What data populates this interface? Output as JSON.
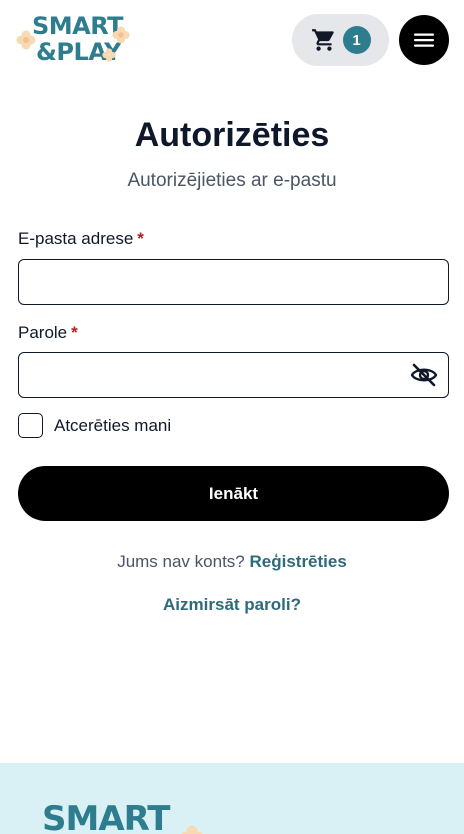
{
  "header": {
    "logo_line1": "SMART",
    "logo_line2": "&PLAY",
    "cart_count": "1",
    "cart_icon": "shopping-cart-icon",
    "menu_icon": "hamburger-menu-icon"
  },
  "login": {
    "title": "Autorizēties",
    "subtitle": "Autorizējieties ar e-pastu",
    "email_label": "E-pasta adrese",
    "password_label": "Parole",
    "required_mark": "*",
    "remember_label": "Atcerēties mani",
    "submit_label": "Ienākt",
    "no_account_text": "Jums nav konts?",
    "register_link": "Reģistrēties",
    "forgot_link": "Aizmirsāt paroli?"
  },
  "footer": {
    "logo_text": "SMART"
  },
  "colors": {
    "brand": "#2e7d8f",
    "link": "#2e6b7a",
    "required": "#b91c1c",
    "footer_bg": "#d9f0f5",
    "cart_bg": "#e5e7eb",
    "flower": "#f7d9b3"
  }
}
